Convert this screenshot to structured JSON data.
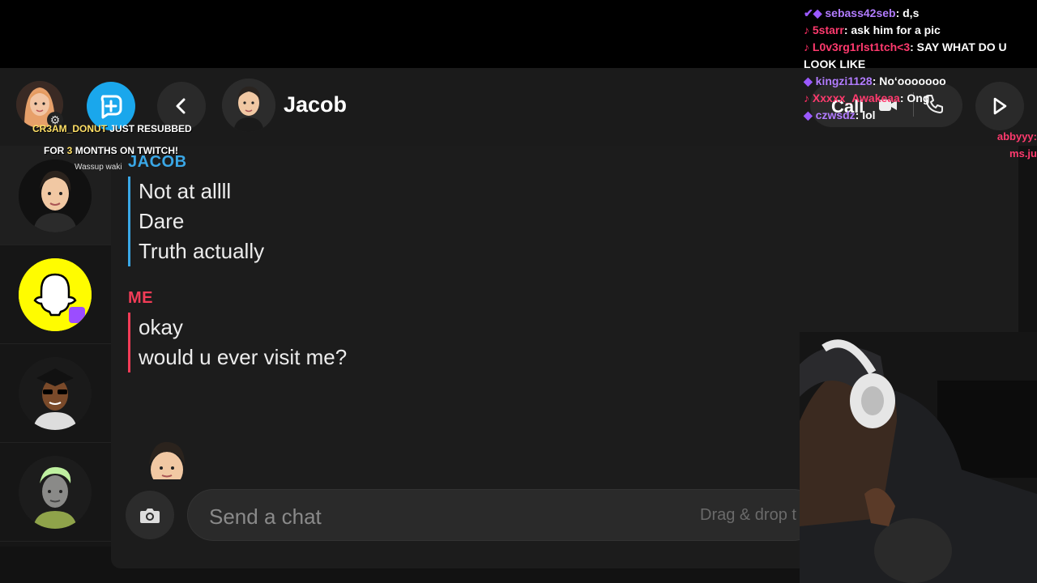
{
  "header": {
    "contact_name": "Jacob",
    "call_label": "Call"
  },
  "messages": {
    "jacob": {
      "sender": "JACOB",
      "color": "#3aa7e6",
      "lines": [
        "Not at allll",
        "Dare",
        "Truth actually"
      ]
    },
    "me": {
      "sender": "ME",
      "color": "#f23c57",
      "lines": [
        "okay",
        "would u ever visit me?"
      ]
    }
  },
  "composer": {
    "placeholder": "Send a chat",
    "drag_hint": "Drag & drop t"
  },
  "stream_overlay": {
    "alert_user": "CR3AM_DONUT",
    "alert_text": " JUST RESUBBED",
    "alert_line2_pre": "FOR ",
    "alert_months": "3",
    "alert_line2_post": " MONTHS ON TWITCH!",
    "alert_message": "Wassup waki",
    "chat": [
      {
        "user": "sebass42seb",
        "text": ": d,s",
        "color": "#b27cff",
        "platform": "twitch"
      },
      {
        "user": "5starr",
        "text": ": ask him for a pic",
        "color": "#ff3a6e",
        "platform": "tiktok"
      },
      {
        "user": "L0v3rg1rlst1tch<3",
        "text": ": SAY WHAT DO U LOOK LIKE",
        "color": "#ff3a6e",
        "platform": "tiktok"
      },
      {
        "user": "kingzi1128",
        "text": ": No‘ooooooo",
        "color": "#b27cff",
        "platform": "twitch"
      },
      {
        "user": "Xxxxx_Awakeaa",
        "text": ": Ong",
        "color": "#ff3a6e",
        "platform": "tiktok"
      },
      {
        "user": "czwsdz",
        "text": ": lol",
        "color": "#b27cff",
        "platform": "twitch"
      }
    ],
    "side_chat": [
      "abbyyy:",
      "ms.ju"
    ]
  }
}
